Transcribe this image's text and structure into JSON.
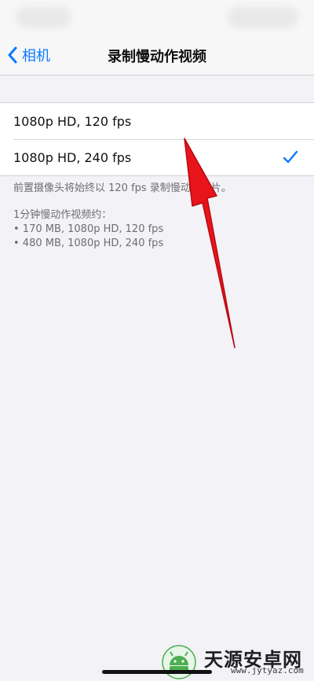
{
  "nav": {
    "back_label": "相机",
    "title": "录制慢动作视频"
  },
  "options": [
    {
      "label": "1080p HD, 120 fps",
      "selected": false
    },
    {
      "label": "1080p HD, 240 fps",
      "selected": true
    }
  ],
  "footer": {
    "note": "前置摄像头将始终以 120 fps 录制慢动作影片。",
    "size_heading": "1分钟慢动作视频约：",
    "sizes": [
      "• 170 MB, 1080p HD, 120 fps",
      "• 480 MB, 1080p HD, 240 fps"
    ]
  },
  "watermark": {
    "name": "天源安卓网",
    "url": "www.jytyaz.com"
  },
  "colors": {
    "accent": "#0a7aff",
    "background": "#f2f2f7",
    "arrow": "#e8141b"
  },
  "icons": {
    "back": "chevron-left-icon",
    "check": "checkmark-icon",
    "annotation": "red-arrow"
  }
}
